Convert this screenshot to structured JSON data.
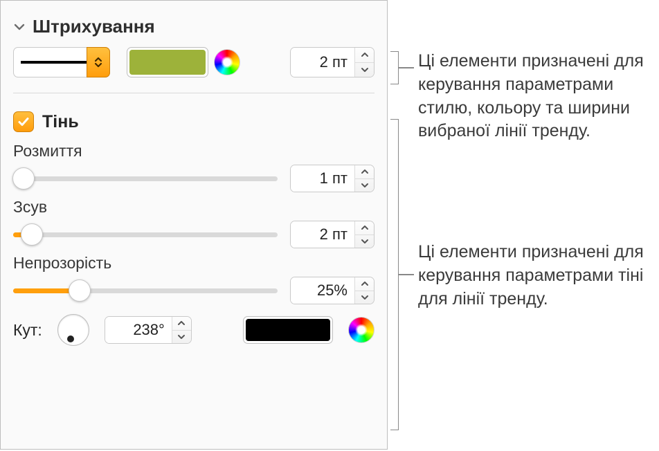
{
  "stroke_section": {
    "title": "Штрихування",
    "line_style_icon": "line-solid",
    "color": "#9db23a",
    "width_value": "2 пт"
  },
  "shadow_section": {
    "checkbox_checked": true,
    "label": "Тінь",
    "blur": {
      "label": "Розмиття",
      "value": "1 пт",
      "percent": 4
    },
    "offset": {
      "label": "Зсув",
      "value": "2 пт",
      "percent": 7
    },
    "opacity": {
      "label": "Непрозорість",
      "value": "25%",
      "percent": 25
    },
    "angle": {
      "label": "Кут:",
      "value": "238°",
      "degrees": 238,
      "color": "#000000"
    }
  },
  "callouts": {
    "stroke": "Ці елементи призначені для керування параметрами стилю, кольору та ширини вибраної лінії тренду.",
    "shadow": "Ці елементи призначені для керування параметрами тіні для лінії тренду."
  },
  "colors": {
    "accent": "#ff9f0d",
    "accent_light": "#ffc03e"
  }
}
